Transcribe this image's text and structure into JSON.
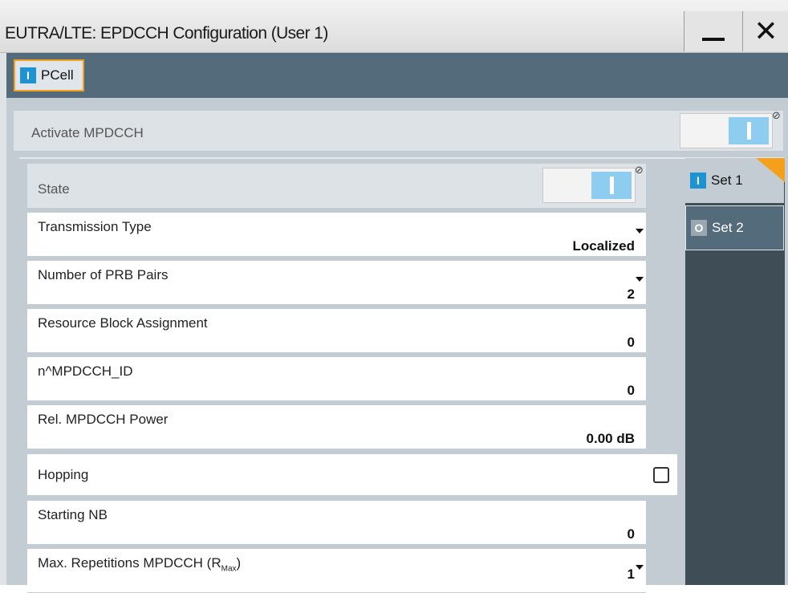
{
  "window": {
    "title": "EUTRA/LTE: EPDCCH Configuration (User 1)",
    "minimize_icon": "minimize-icon",
    "close_icon": "close-icon",
    "close_glyph": "✕"
  },
  "tabs": {
    "pcell": {
      "indicator": "I",
      "label": "PCell"
    }
  },
  "activate": {
    "label": "Activate MPDCCH",
    "state": "on",
    "glyph": "⊘"
  },
  "sets": [
    {
      "indicator": "I",
      "label": "Set 1",
      "active": true
    },
    {
      "indicator": "O",
      "label": "Set 2",
      "active": false
    }
  ],
  "fields": {
    "state": {
      "label": "State",
      "value": "on",
      "glyph": "⊘"
    },
    "transmission_type": {
      "label": "Transmission Type",
      "value": "Localized"
    },
    "prb_pairs": {
      "label": "Number of PRB Pairs",
      "value": "2"
    },
    "rb_assignment": {
      "label": "Resource Block Assignment",
      "value": "0"
    },
    "mpdcch_id": {
      "label": "n^MPDCCH_ID",
      "value": "0"
    },
    "power": {
      "label": "Rel. MPDCCH Power",
      "value": "0.00 dB"
    },
    "hopping": {
      "label": "Hopping",
      "checked": false
    },
    "starting_nb": {
      "label": "Starting NB",
      "value": "0"
    },
    "max_reps": {
      "label": "Max. Repetitions MPDCCH (R",
      "sub": "Max",
      "label_end": ")",
      "value": "1"
    }
  },
  "colors": {
    "accent_orange": "#f5a01a",
    "toggle_blue": "#8fcdf0",
    "indicator_blue": "#1d93d2",
    "tabbar": "#546b7b",
    "panel": "#c4ccd3"
  }
}
